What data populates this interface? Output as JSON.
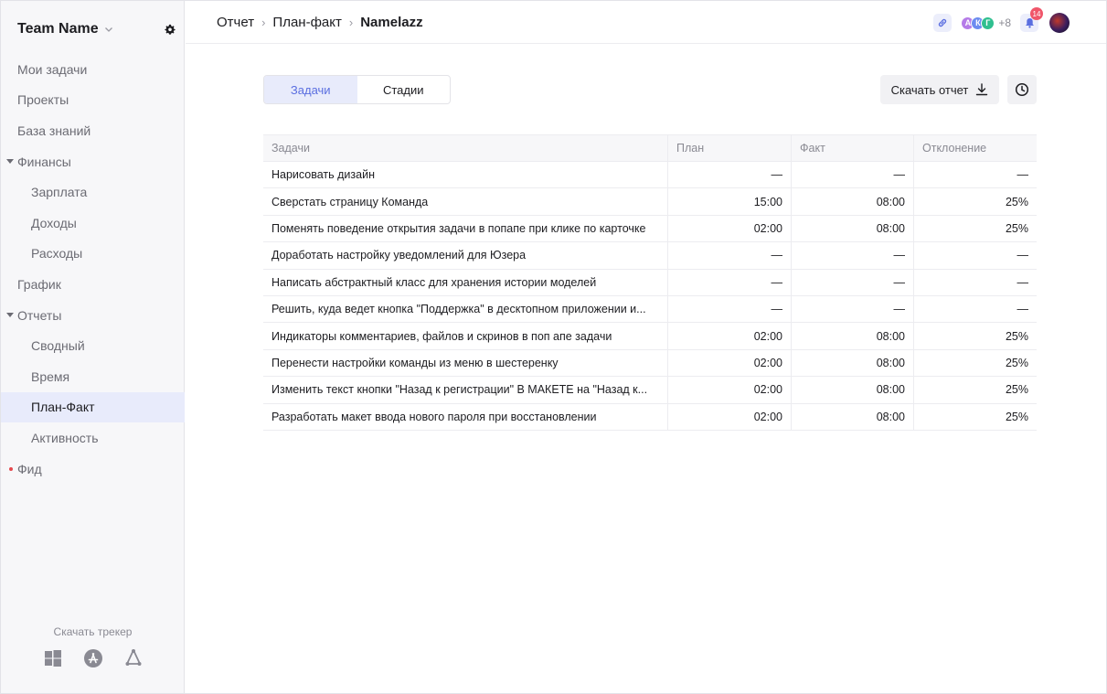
{
  "sidebar": {
    "team_name": "Team Name",
    "items": [
      {
        "label": "Мои задачи",
        "type": "top"
      },
      {
        "label": "Проекты",
        "type": "top"
      },
      {
        "label": "База знаний",
        "type": "top"
      },
      {
        "label": "Финансы",
        "type": "group"
      },
      {
        "label": "Зарплата",
        "type": "sub"
      },
      {
        "label": "Доходы",
        "type": "sub"
      },
      {
        "label": "Расходы",
        "type": "sub"
      },
      {
        "label": "График",
        "type": "top"
      },
      {
        "label": "Отчеты",
        "type": "group"
      },
      {
        "label": "Сводный",
        "type": "sub"
      },
      {
        "label": "Время",
        "type": "sub"
      },
      {
        "label": "План-Факт",
        "type": "sub",
        "active": true
      },
      {
        "label": "Активность",
        "type": "sub"
      },
      {
        "label": "Фид",
        "type": "dot"
      }
    ],
    "tracker_label": "Скачать трекер",
    "os_icons": [
      "windows-icon",
      "app-store-icon",
      "linux-icon"
    ]
  },
  "header": {
    "breadcrumbs": [
      "Отчет",
      "План-факт",
      "Namelazz"
    ],
    "avatars": [
      {
        "initial": "А",
        "color": "#b57be8"
      },
      {
        "initial": "К",
        "color": "#6c8cf0"
      },
      {
        "initial": "Г",
        "color": "#2fbf8f"
      }
    ],
    "more_members": "+8",
    "notifications": "14"
  },
  "toolbar": {
    "tabs": [
      {
        "label": "Задачи",
        "active": true
      },
      {
        "label": "Стадии",
        "active": false
      }
    ],
    "download_label": "Скачать отчет"
  },
  "table": {
    "columns": [
      "Задачи",
      "План",
      "Факт",
      "Отклонение"
    ],
    "rows": [
      {
        "task": "Нарисовать дизайн",
        "plan": "—",
        "fact": "—",
        "deviation": "—"
      },
      {
        "task": "Сверстать страницу Команда",
        "plan": "15:00",
        "fact": "08:00",
        "deviation": "25%"
      },
      {
        "task": "Поменять поведение открытия задачи в попапе при клике по карточке",
        "plan": "02:00",
        "fact": "08:00",
        "deviation": "25%"
      },
      {
        "task": "Доработать настройку уведомлений для Юзера",
        "plan": "—",
        "fact": "—",
        "deviation": "—"
      },
      {
        "task": "Написать абстрактный класс для хранения истории моделей",
        "plan": "—",
        "fact": "—",
        "deviation": "—"
      },
      {
        "task": "Решить, куда ведет кнопка \"Поддержка\" в десктопном приложении и...",
        "plan": "—",
        "fact": "—",
        "deviation": "—"
      },
      {
        "task": "Индикаторы комментариев, файлов и скринов в поп апе задачи",
        "plan": "02:00",
        "fact": "08:00",
        "deviation": "25%"
      },
      {
        "task": "Перенести настройки команды из меню в шестеренку",
        "plan": "02:00",
        "fact": "08:00",
        "deviation": "25%"
      },
      {
        "task": "Изменить текст кнопки \"Назад к регистрации\" В МАКЕТЕ на \"Назад к...",
        "plan": "02:00",
        "fact": "08:00",
        "deviation": "25%"
      },
      {
        "task": "Разработать макет ввода нового пароля при восстановлении",
        "plan": "02:00",
        "fact": "08:00",
        "deviation": "25%"
      }
    ]
  },
  "colors": {
    "accent": "#5a6ee0",
    "active_bg": "#e8ebfb",
    "sidebar_bg": "#f7f7f9",
    "badge": "#f0566a"
  }
}
